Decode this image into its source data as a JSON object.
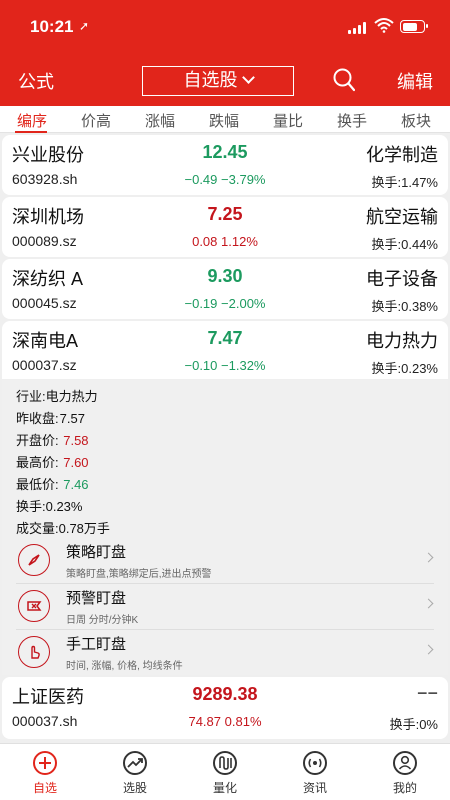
{
  "status_bar": {
    "time": "10:21"
  },
  "nav": {
    "left": "公式",
    "title": "自选股",
    "right": "编辑"
  },
  "sort_tabs": [
    "编序",
    "价高",
    "涨幅",
    "跌幅",
    "量比",
    "换手",
    "板块"
  ],
  "stocks": [
    {
      "name": "兴业股份",
      "code": "603928.sh",
      "price": "12.45",
      "change": "−0.49",
      "change_pct": "−3.79%",
      "sector": "化学制造",
      "turnover": "换手:1.47%",
      "trend": "down"
    },
    {
      "name": "深圳机场",
      "code": "000089.sz",
      "price": "7.25",
      "change": "0.08",
      "change_pct": "1.12%",
      "sector": "航空运输",
      "turnover": "换手:0.44%",
      "trend": "up"
    },
    {
      "name": "深纺织 A",
      "code": "000045.sz",
      "price": "9.30",
      "change": "−0.19",
      "change_pct": "−2.00%",
      "sector": "电子设备",
      "turnover": "换手:0.38%",
      "trend": "down"
    },
    {
      "name": "深南电A",
      "code": "000037.sz",
      "price": "7.47",
      "change": "−0.10",
      "change_pct": "−1.32%",
      "sector": "电力热力",
      "turnover": "换手:0.23%",
      "trend": "down"
    }
  ],
  "detail": {
    "industry": "行业:电力热力",
    "prev_close_label": "昨收盘:",
    "prev_close": "7.57",
    "open_label": "开盘价: ",
    "open": "7.58",
    "high_label": "最高价: ",
    "high": "7.60",
    "low_label": "最低价: ",
    "low": "7.46",
    "turnover": "换手:0.23%",
    "volume": "成交量:0.78万手"
  },
  "monitors": [
    {
      "title": "策略盯盘",
      "subtitle": "策略盯盘,策略绑定后,进出点预警",
      "icon": "compass-icon"
    },
    {
      "title": "预警盯盘",
      "subtitle": "日周 分时/分钟K",
      "icon": "alert-icon"
    },
    {
      "title": "手工盯盘",
      "subtitle": "时间, 涨幅, 价格, 均线条件",
      "icon": "hand-icon"
    }
  ],
  "index_row": {
    "name": "上证医药",
    "code": "000037.sh",
    "price": "9289.38",
    "change": "74.87",
    "change_pct": "0.81%",
    "sector": "−−",
    "turnover": "换手:0%"
  },
  "tabbar": [
    {
      "label": "自选",
      "icon": "plus-circle-icon",
      "active": true
    },
    {
      "label": "选股",
      "icon": "trend-icon",
      "active": false
    },
    {
      "label": "量化",
      "icon": "quant-icon",
      "active": false
    },
    {
      "label": "资讯",
      "icon": "broadcast-icon",
      "active": false
    },
    {
      "label": "我的",
      "icon": "person-icon",
      "active": false
    }
  ],
  "colors": {
    "brand": "#e1251b",
    "up": "#c4151c",
    "down": "#1c9a5f"
  }
}
